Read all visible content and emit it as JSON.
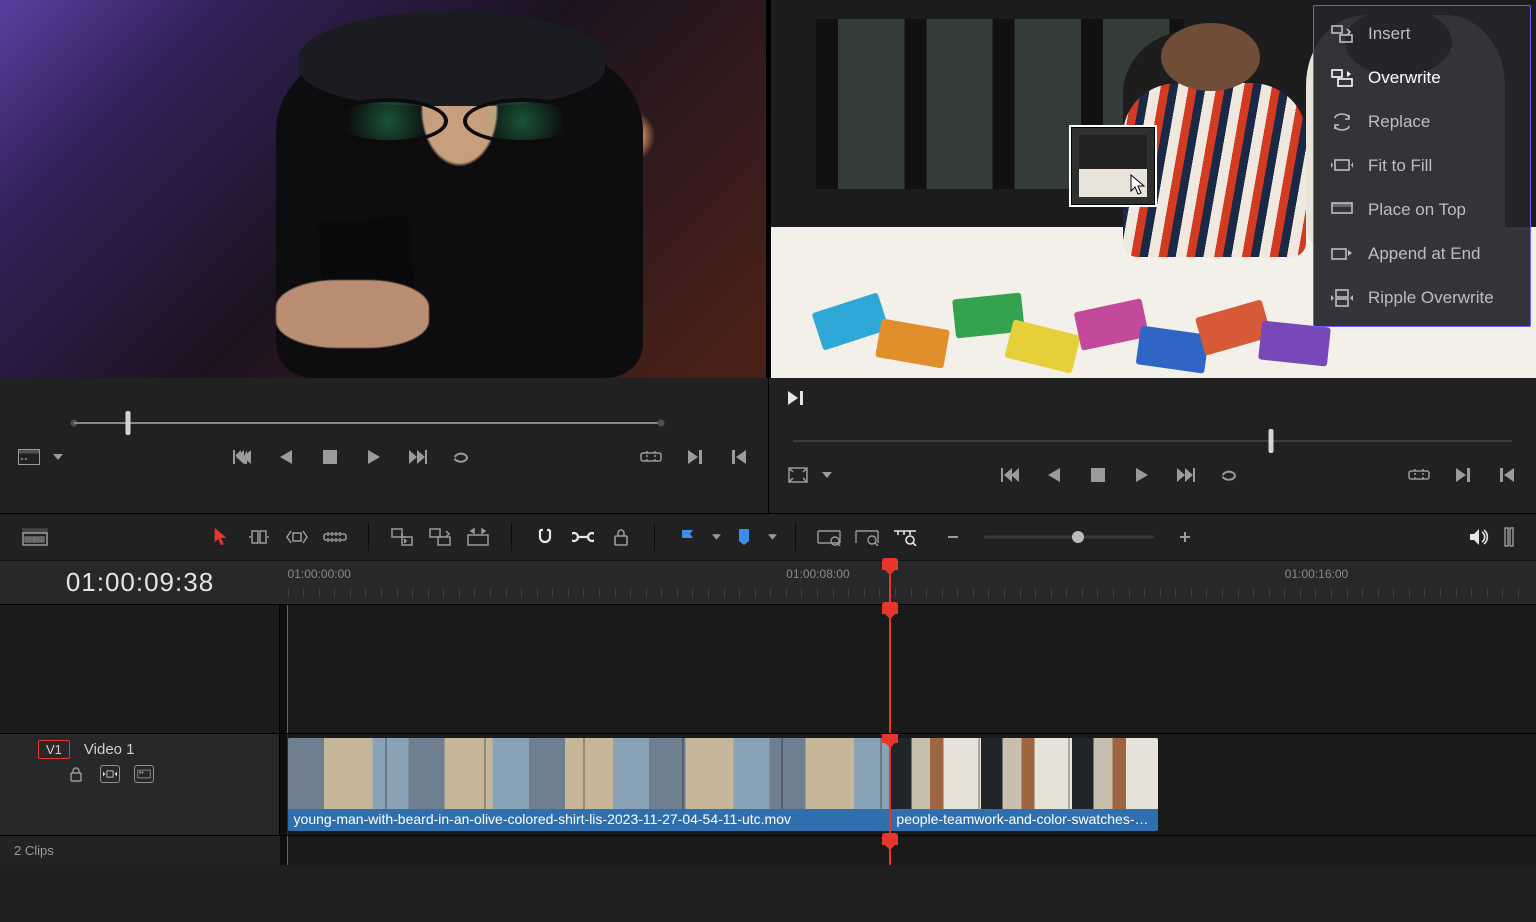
{
  "edit_menu": {
    "items": [
      {
        "id": "insert",
        "label": "Insert",
        "active": false
      },
      {
        "id": "overwrite",
        "label": "Overwrite",
        "active": true
      },
      {
        "id": "replace",
        "label": "Replace",
        "active": false
      },
      {
        "id": "fit-to-fill",
        "label": "Fit to Fill",
        "active": false
      },
      {
        "id": "place-on-top",
        "label": "Place on Top",
        "active": false
      },
      {
        "id": "append-at-end",
        "label": "Append at End",
        "active": false
      },
      {
        "id": "ripple-overwrite",
        "label": "Ripple Overwrite",
        "active": false
      }
    ]
  },
  "source_transport": {
    "jog_start_pct": 7.0,
    "jog_end_pct": 88.5,
    "jog_pos_pct": 14.5
  },
  "program_transport": {
    "jog_pos_pct": 66.5
  },
  "timeline": {
    "timecode": "01:00:09:38",
    "ruler_ticks": [
      {
        "label": "01:00:00:00",
        "pct": 0.6
      },
      {
        "label": "01:00:08:00",
        "pct": 40.3
      },
      {
        "label": "01:00:16:00",
        "pct": 80.0
      }
    ],
    "playhead_pct": 48.5,
    "track_label_badge": "V1",
    "track_label_name": "Video 1",
    "status": "2 Clips",
    "clips": [
      {
        "id": "clip-a",
        "name": "young-man-with-beard-in-an-olive-colored-shirt-lis-2023-11-27-04-54-11-utc.mov",
        "start_pct": 0.6,
        "width_pct": 48.0,
        "selected": true,
        "thumbs": "a"
      },
      {
        "id": "clip-b",
        "name": "people-teamwork-and-color-swatches-o...",
        "start_pct": 48.6,
        "width_pct": 21.3,
        "selected": false,
        "thumbs": "b"
      }
    ]
  },
  "toolbar": {
    "zoom_pos_pct": 55
  }
}
